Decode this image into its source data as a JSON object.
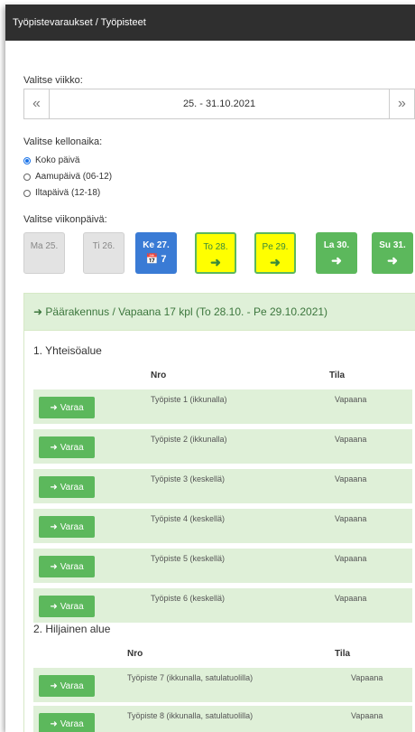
{
  "breadcrumb": "Työpistevaraukset / Työpisteet",
  "week_label": "Valitse viikko:",
  "week": {
    "prev": "«",
    "range": "25. - 31.10.2021",
    "next": "»"
  },
  "time_label": "Valitse kellonaika:",
  "time_options": [
    {
      "label": "Koko päivä",
      "selected": true
    },
    {
      "label": "Aamupäivä (06-12)",
      "selected": false
    },
    {
      "label": "Iltapäivä (12-18)",
      "selected": false
    }
  ],
  "day_label": "Valitse viikonpäivä:",
  "days": [
    {
      "name": "Ma 25.",
      "icon": "",
      "state": "past"
    },
    {
      "name": "Ti 26.",
      "icon": "",
      "state": "past"
    },
    {
      "name": "Ke 27.",
      "icon": "📅 7",
      "state": "today"
    },
    {
      "name": "To 28.",
      "icon": "➜",
      "state": "yellow"
    },
    {
      "name": "Pe 29.",
      "icon": "➜",
      "state": "yellow"
    },
    {
      "name": "La 30.",
      "icon": "➜",
      "state": "green"
    },
    {
      "name": "Su 31.",
      "icon": "➜",
      "state": "green"
    }
  ],
  "panel": {
    "title": "➜ Päärakennus / Vapaana 17 kpl (To 28.10. - Pe 29.10.2021)",
    "sections": [
      {
        "title": "1. Yhteisöalue",
        "col_nro": "Nro",
        "col_tila": "Tila",
        "rows": [
          {
            "button": "Varaa",
            "nro": "Työpiste 1 (ikkunalla)",
            "tila": "Vapaana"
          },
          {
            "button": "Varaa",
            "nro": "Työpiste 2 (ikkunalla)",
            "tila": "Vapaana"
          },
          {
            "button": "Varaa",
            "nro": "Työpiste 3 (keskellä)",
            "tila": "Vapaana"
          },
          {
            "button": "Varaa",
            "nro": "Työpiste 4 (keskellä)",
            "tila": "Vapaana"
          },
          {
            "button": "Varaa",
            "nro": "Työpiste 5 (keskellä)",
            "tila": "Vapaana"
          },
          {
            "button": "Varaa",
            "nro": "Työpiste 6 (keskellä)",
            "tila": "Vapaana"
          }
        ]
      },
      {
        "title": "2. Hiljainen alue",
        "col_nro": "Nro",
        "col_tila": "Tila",
        "rows": [
          {
            "button": "Varaa",
            "nro": "Työpiste 7 (ikkunalla, satulatuolilla)",
            "tila": "Vapaana"
          },
          {
            "button": "Varaa",
            "nro": "Työpiste 8 (ikkunalla, satulatuolilla)",
            "tila": "Vapaana"
          }
        ]
      }
    ]
  }
}
